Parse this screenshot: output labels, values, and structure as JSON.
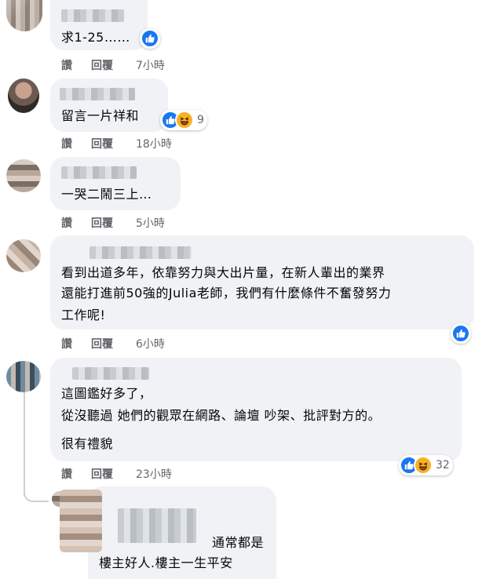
{
  "colors": {
    "bubble": "#f0f2f5",
    "action_text": "#65676b",
    "like_blue": "#1877f2",
    "haha_yellow": "#f7b125",
    "thread_line": "#ccd0d5"
  },
  "comments": [
    {
      "text_lines": [
        "求1-25……"
      ],
      "actions": {
        "like": "讚",
        "reply": "回覆",
        "time": "7小時"
      },
      "reactions": {
        "icons": [
          "like-icon"
        ],
        "count": ""
      }
    },
    {
      "text_lines": [
        "留言一片祥和"
      ],
      "actions": {
        "like": "讚",
        "reply": "回覆",
        "time": "18小時"
      },
      "reactions": {
        "icons": [
          "like-icon",
          "haha-icon"
        ],
        "count": "9"
      }
    },
    {
      "text_lines": [
        "一哭二鬧三上…"
      ],
      "actions": {
        "like": "讚",
        "reply": "回覆",
        "time": "5小時"
      },
      "reactions": {
        "icons": [],
        "count": ""
      }
    },
    {
      "text_lines": [
        "看到出道多年，依靠努力與大出片量，在新人輩出的業界",
        "還能打進前50強的Julia老師，我們有什麼條件不奮發努力",
        "工作呢!"
      ],
      "actions": {
        "like": "讚",
        "reply": "回覆",
        "time": "6小時"
      },
      "reactions": {
        "icons": [
          "like-icon"
        ],
        "count": ""
      }
    },
    {
      "text_lines": [
        "這圖鑑好多了，",
        "從沒聽過 她們的觀眾在網路、論壇 吵架、批評對方的。",
        "很有禮貌"
      ],
      "actions": {
        "like": "讚",
        "reply": "回覆",
        "time": "23小時"
      },
      "reactions": {
        "icons": [
          "like-icon",
          "haha-icon"
        ],
        "count": "32"
      }
    }
  ],
  "reply": {
    "text_lines": [
      "通常都是",
      "樓主好人.樓主一生平安"
    ]
  }
}
